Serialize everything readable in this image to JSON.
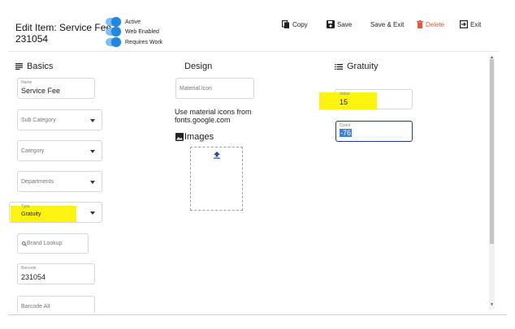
{
  "header": {
    "title_line1": "Edit Item: Service Fee",
    "title_line2": "231054"
  },
  "toggles": [
    {
      "label": "Active",
      "on": true
    },
    {
      "label": "Web Enabled",
      "on": true
    },
    {
      "label": "Requires Work",
      "on": true
    }
  ],
  "toolbar": {
    "copy": "Copy",
    "save": "Save",
    "save_exit": "Save & Exit",
    "delete": "Delete",
    "exit": "Exit"
  },
  "basics": {
    "title": "Basics",
    "name_label": "Name",
    "name_value": "Service Fee",
    "sub_category_placeholder": "Sub Category",
    "category_placeholder": "Category",
    "departments_placeholder": "Departments",
    "type_label": "Type",
    "type_value": "Gratuity",
    "brand_lookup_placeholder": "Brand Lookup",
    "barcode_label": "Barcode",
    "barcode_value": "231054",
    "barcode_alt_placeholder": "Barcode Alt"
  },
  "design": {
    "title": "Design",
    "material_icon_placeholder": "Material.Icon",
    "hint_line1": "Use material icons from",
    "hint_line2": "fonts.google.com",
    "images_title": "Images"
  },
  "gratuity": {
    "title": "Gratuity",
    "value_label": "Value",
    "value_value": "15",
    "count_label": "Count",
    "count_value": "-76"
  },
  "colors": {
    "accent": "#1e88e5",
    "delete": "#e35a3a",
    "highlight": "#fdf210",
    "focus_border": "#1a3a8a"
  }
}
